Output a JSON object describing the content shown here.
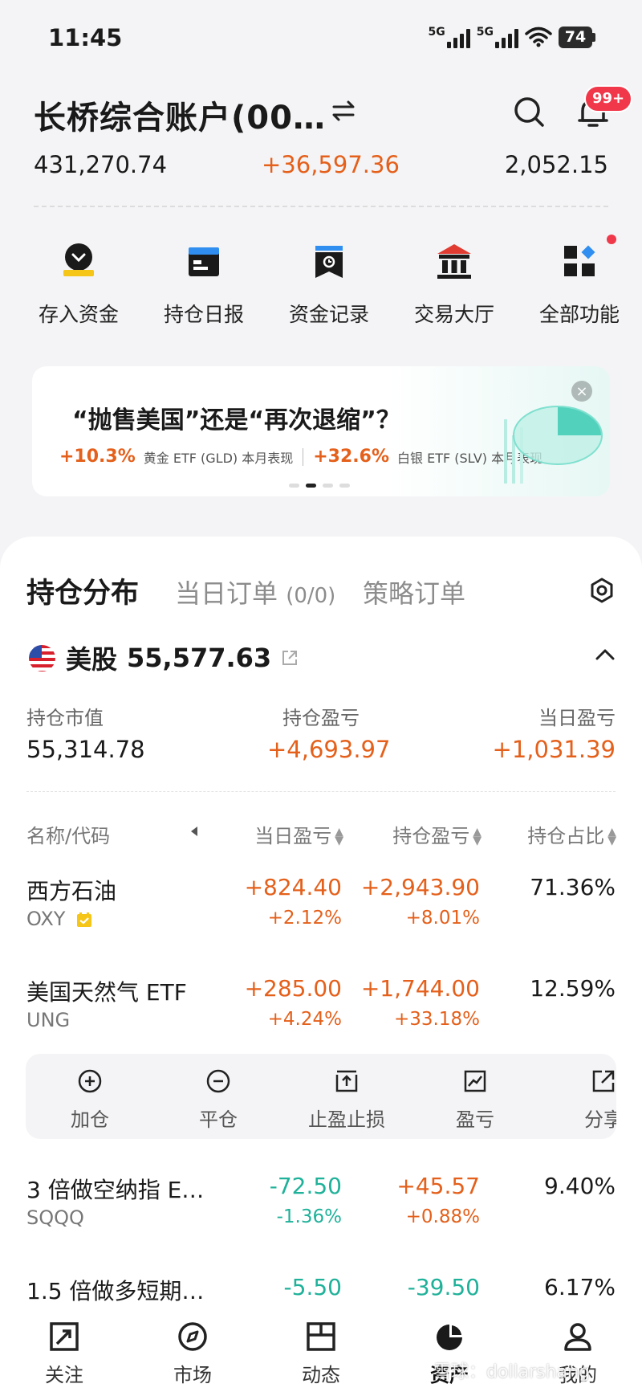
{
  "status": {
    "time": "11:45",
    "net1": "5G",
    "net2": "5G",
    "battery": "74"
  },
  "header": {
    "account_title": "长桥综合账户(00…",
    "badge": "99+",
    "total_assets": "431,270.74",
    "total_pnl": "+36,597.36",
    "cash": "2,052.15"
  },
  "quick_actions": [
    {
      "label": "存入资金",
      "icon": "deposit-icon"
    },
    {
      "label": "持仓日报",
      "icon": "daily-report-icon"
    },
    {
      "label": "资金记录",
      "icon": "fund-record-icon"
    },
    {
      "label": "交易大厅",
      "icon": "trading-hall-icon"
    },
    {
      "label": "全部功能",
      "icon": "all-functions-icon"
    }
  ],
  "banner": {
    "title": "“抛售美国”还是“再次退缩”？",
    "stat1_value": "+10.3%",
    "stat1_label": "黄金 ETF (GLD) 本月表现",
    "stat2_value": "+32.6%",
    "stat2_label": "白银 ETF (SLV) 本月表现",
    "close": "×"
  },
  "tabs": {
    "positions": "持仓分布",
    "today_orders": "当日订单",
    "today_orders_count": "(0/0)",
    "strategy_orders": "策略订单"
  },
  "market": {
    "name": "美股",
    "value": "55,577.63",
    "market_value_label": "持仓市值",
    "market_value": "55,314.78",
    "position_pnl_label": "持仓盈亏",
    "position_pnl": "+4,693.97",
    "day_pnl_label": "当日盈亏",
    "day_pnl": "+1,031.39"
  },
  "table": {
    "headers": [
      "名称/代码",
      "当日盈亏",
      "持仓盈亏",
      "持仓占比"
    ],
    "rows": [
      {
        "name": "西方石油",
        "code": "OXY",
        "day_pnl": "+824.40",
        "day_pct": "+2.12%",
        "pos_pnl": "+2,943.90",
        "pos_pct": "+8.01%",
        "ratio": "71.36%"
      },
      {
        "name": "美国天然气 ETF",
        "code": "UNG",
        "day_pnl": "+285.00",
        "day_pct": "+4.24%",
        "pos_pnl": "+1,744.00",
        "pos_pct": "+33.18%",
        "ratio": "12.59%"
      },
      {
        "name": "3 倍做空纳指 E…",
        "code": "SQQQ",
        "day_pnl": "-72.50",
        "day_pct": "-1.36%",
        "pos_pnl": "+45.57",
        "pos_pct": "+0.88%",
        "ratio": "9.40%"
      },
      {
        "name": "1.5 倍做多短期…",
        "code": "",
        "day_pnl": "-5.50",
        "day_pct": "",
        "pos_pnl": "-39.50",
        "pos_pct": "",
        "ratio": "6.17%"
      }
    ]
  },
  "row_actions": [
    {
      "label": "加仓",
      "icon": "plus-circle-icon"
    },
    {
      "label": "平仓",
      "icon": "minus-circle-icon"
    },
    {
      "label": "止盈止损",
      "icon": "take-profit-stop-loss-icon"
    },
    {
      "label": "盈亏",
      "icon": "pnl-chart-icon"
    },
    {
      "label": "分享",
      "icon": "share-icon"
    }
  ],
  "bottom_nav": [
    {
      "label": "关注",
      "icon": "watchlist-icon"
    },
    {
      "label": "市场",
      "icon": "market-compass-icon"
    },
    {
      "label": "动态",
      "icon": "feed-icon"
    },
    {
      "label": "资产",
      "icon": "assets-pie-icon"
    },
    {
      "label": "我的",
      "icon": "profile-icon"
    }
  ],
  "watermark": "雪球：dollarshang",
  "colors": {
    "up": "#e4601b",
    "down": "#1fb199",
    "badge": "#f0384a",
    "accent_yellow": "#f5c518"
  }
}
